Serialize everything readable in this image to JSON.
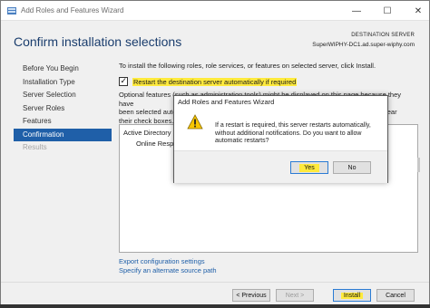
{
  "window": {
    "title": "Add Roles and Features Wizard",
    "minimize": "—",
    "maximize": "☐",
    "close": "✕"
  },
  "header": {
    "title": "Confirm installation selections",
    "destination_label": "DESTINATION SERVER",
    "destination_server": "SuperWIPHY-DC1.ad.super-wiphy.com"
  },
  "nav": {
    "items": [
      {
        "label": "Before You Begin",
        "state": "normal"
      },
      {
        "label": "Installation Type",
        "state": "normal"
      },
      {
        "label": "Server Selection",
        "state": "normal"
      },
      {
        "label": "Server Roles",
        "state": "normal"
      },
      {
        "label": "Features",
        "state": "normal"
      },
      {
        "label": "Confirmation",
        "state": "active"
      },
      {
        "label": "Results",
        "state": "disabled"
      }
    ]
  },
  "content": {
    "intro": "To install the following roles, role services, or features on selected server, click Install.",
    "restart_checkbox_label": "Restart the destination server automatically if required",
    "restart_checked": true,
    "optional_text": "Optional features (such as administration tools) might be displayed on this page because they have been selected autom                                                                         ps to clear their check boxes.",
    "optional_line1": "Optional features (such as administration tools) might be displayed on this page because they have",
    "optional_line2": "been selected autor",
    "optional_line2_tail": "ps to clear",
    "optional_line3": "their check boxes.",
    "features": [
      "Active Directory Ce",
      "Online Respor"
    ],
    "links": {
      "export": "Export configuration settings",
      "alternate_source": "Specify an alternate source path"
    }
  },
  "footer": {
    "previous": "< Previous",
    "next": "Next >",
    "install": "Install",
    "cancel": "Cancel"
  },
  "dialog": {
    "title": "Add Roles and Features Wizard",
    "message": "If a restart is required, this server restarts automatically, without additional notifications. Do you want to allow automatic restarts?",
    "yes": "Yes",
    "no": "No",
    "icon": "warning-icon"
  },
  "colors": {
    "accent": "#1f5fa8",
    "highlight": "#ffea3d",
    "title_blue": "#1a3d6d"
  }
}
